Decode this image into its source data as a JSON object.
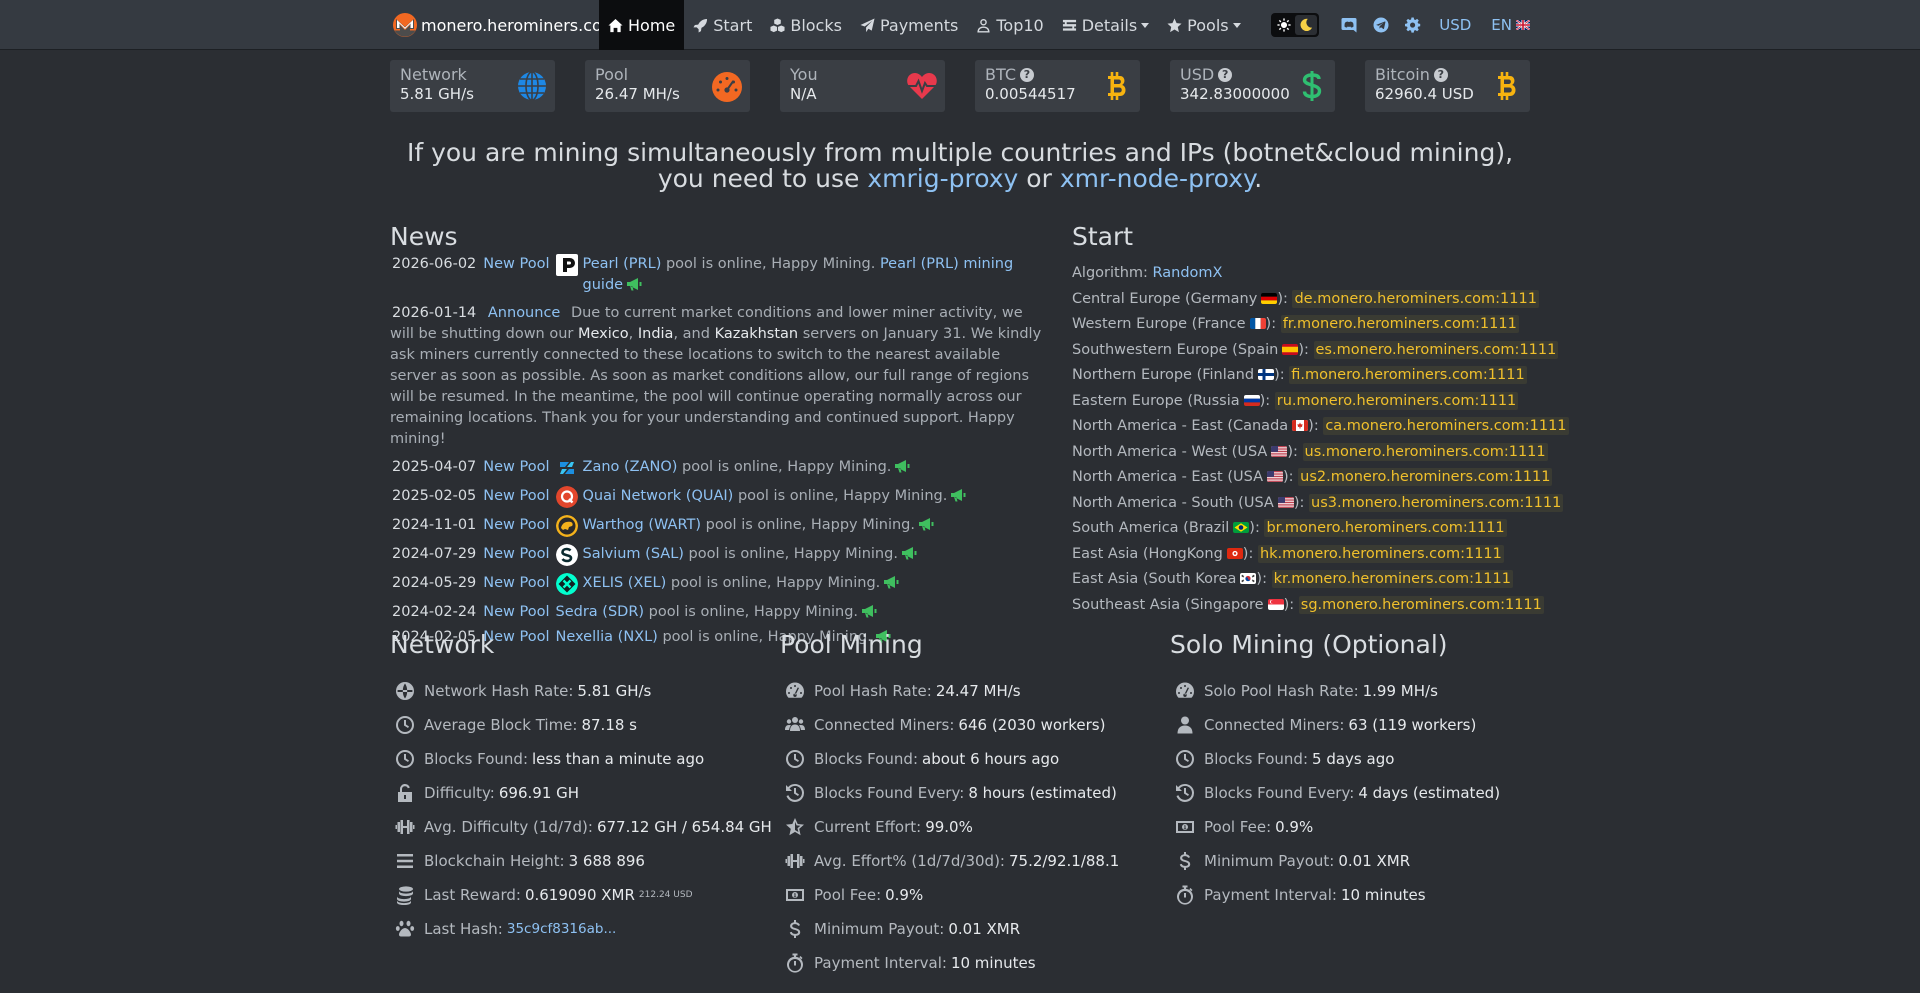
{
  "nav": {
    "brand": "monero.herominers.com",
    "items": [
      {
        "label": "Home",
        "icon": "home-icon",
        "active": true
      },
      {
        "label": "Start",
        "icon": "rocket-icon"
      },
      {
        "label": "Blocks",
        "icon": "cubes-icon"
      },
      {
        "label": "Payments",
        "icon": "paper-plane-icon"
      },
      {
        "label": "Top10",
        "icon": "user-icon"
      },
      {
        "label": "Details",
        "icon": "list-icon",
        "dropdown": true
      },
      {
        "label": "Pools",
        "icon": "star-icon",
        "dropdown": true
      }
    ],
    "currency": "USD",
    "language": "EN"
  },
  "stats": {
    "network": {
      "label": "Network",
      "value": "5.81 GH/s"
    },
    "pool": {
      "label": "Pool",
      "value": "26.47 MH/s"
    },
    "you": {
      "label": "You",
      "value": "N/A"
    },
    "btc": {
      "label": "BTC",
      "value": "0.00544517"
    },
    "usd": {
      "label": "USD",
      "value": "342.83000000"
    },
    "bitcoin": {
      "label": "Bitcoin",
      "value": "62960.4 USD"
    }
  },
  "banner": {
    "text_1": "If you are mining simultaneously from multiple countries and IPs (botnet&cloud mining), you need to use ",
    "link_1": "xmrig-proxy",
    "text_2": " or ",
    "link_2": "xmr-node-proxy",
    "text_3": "."
  },
  "news": {
    "title": "News",
    "items": [
      {
        "date": "2026-06-02",
        "tag": "New Pool",
        "coin": "Pearl (PRL)",
        "msg": " pool is online, Happy Mining. ",
        "guide": "Pearl (PRL) mining guide",
        "icon": "pearl-icon"
      },
      {
        "date": "2025-04-07",
        "tag": "New Pool",
        "coin": "Zano (ZANO)",
        "msg": " pool is online, Happy Mining.",
        "icon": "zano-icon"
      },
      {
        "date": "2025-02-05",
        "tag": "New Pool",
        "coin": "Quai Network (QUAI)",
        "msg": " pool is online, Happy Mining.",
        "icon": "quai-icon"
      },
      {
        "date": "2024-11-01",
        "tag": "New Pool",
        "coin": "Warthog (WART)",
        "msg": " pool is online, Happy Mining.",
        "icon": "warthog-icon"
      },
      {
        "date": "2024-07-29",
        "tag": "New Pool",
        "coin": "Salvium (SAL)",
        "msg": " pool is online, Happy Mining.",
        "icon": "salvium-icon"
      },
      {
        "date": "2024-05-29",
        "tag": "New Pool",
        "coin": "XELIS (XEL)",
        "msg": " pool is online, Happy Mining.",
        "icon": "xelis-icon"
      },
      {
        "date": "2024-02-24",
        "tag": "New Pool",
        "coin": "Sedra (SDR)",
        "msg": " pool is online, Happy Mining."
      },
      {
        "date": "2024-02-05",
        "tag": "New Pool",
        "coin": "Nexellia (NXL)",
        "msg": " pool is online, Happy Mining."
      }
    ],
    "announce": {
      "date": "2026-01-14",
      "tag": "Announce",
      "p1": " Due to current market conditions and lower miner activity, we will be shutting down our ",
      "c1": "Mexico",
      "p2": ", ",
      "c2": "India",
      "p3": ", and ",
      "c3": "Kazakhstan",
      "p4": " servers on January 31. We kindly ask miners currently connected to these locations to switch to the nearest available server as soon as possible. As soon as market conditions allow, our full range of regions will be resumed. In the meantime, the pool will continue operating normally across our remaining locations. Thank you for your understanding and continued support. Happy mining!"
    }
  },
  "start": {
    "title": "Start",
    "algorithm_label": "Algorithm: ",
    "algorithm": "RandomX",
    "servers": [
      {
        "region": "Central Europe (Germany",
        "flag": "de",
        "host": "de.monero.herominers.com:1111"
      },
      {
        "region": "Western Europe (France",
        "flag": "fr",
        "host": "fr.monero.herominers.com:1111"
      },
      {
        "region": "Southwestern Europe (Spain",
        "flag": "es",
        "host": "es.monero.herominers.com:1111"
      },
      {
        "region": "Northern Europe (Finland",
        "flag": "fi",
        "host": "fi.monero.herominers.com:1111"
      },
      {
        "region": "Eastern Europe (Russia",
        "flag": "ru",
        "host": "ru.monero.herominers.com:1111"
      },
      {
        "region": "North America - East (Canada",
        "flag": "ca",
        "host": "ca.monero.herominers.com:1111"
      },
      {
        "region": "North America - West (USA",
        "flag": "us",
        "host": "us.monero.herominers.com:1111"
      },
      {
        "region": "North America - East (USA",
        "flag": "us",
        "host": "us2.monero.herominers.com:1111"
      },
      {
        "region": "North America - South (USA",
        "flag": "us",
        "host": "us3.monero.herominers.com:1111"
      },
      {
        "region": "South America (Brazil",
        "flag": "br",
        "host": "br.monero.herominers.com:1111"
      },
      {
        "region": "East Asia (HongKong",
        "flag": "hk",
        "host": "hk.monero.herominers.com:1111"
      },
      {
        "region": "East Asia (South Korea",
        "flag": "kr",
        "host": "kr.monero.herominers.com:1111"
      },
      {
        "region": "Southeast Asia (Singapore",
        "flag": "sg",
        "host": "sg.monero.herominers.com:1111"
      }
    ]
  },
  "network": {
    "title": "Network",
    "rows": [
      {
        "icon": "globe-icon",
        "k": "Network Hash Rate:",
        "v": "5.81 GH/s"
      },
      {
        "icon": "clock-icon",
        "k": "Average Block Time:",
        "v": "87.18 s"
      },
      {
        "icon": "clock-icon",
        "k": "Blocks Found:",
        "v": "less than a minute ago"
      },
      {
        "icon": "unlock-icon",
        "k": "Difficulty:",
        "v": "696.91 GH"
      },
      {
        "icon": "dumbbell-icon",
        "k": "Avg. Difficulty (1d/7d):",
        "v": "677.12 GH / 654.84 GH"
      },
      {
        "icon": "bars-icon",
        "k": "Blockchain Height:",
        "v": "3 688 896"
      },
      {
        "icon": "coins-icon",
        "k": "Last Reward:",
        "v": "0.619090 XMR",
        "sup": "212.24 USD"
      },
      {
        "icon": "paw-icon",
        "k": "Last Hash:",
        "v": "35c9cf8316ab...",
        "link": true
      }
    ]
  },
  "pool_mining": {
    "title": "Pool Mining",
    "rows": [
      {
        "icon": "gauge-icon",
        "k": "Pool Hash Rate:",
        "v": "24.47 MH/s"
      },
      {
        "icon": "users-icon",
        "k": "Connected Miners:",
        "v": "646 (2030 workers)"
      },
      {
        "icon": "clock-icon",
        "k": "Blocks Found:",
        "v": "about 6 hours ago"
      },
      {
        "icon": "history-icon",
        "k": "Blocks Found Every:",
        "v": "8 hours (estimated)"
      },
      {
        "icon": "star-half-icon",
        "k": "Current Effort:",
        "v": "99.0%"
      },
      {
        "icon": "dumbbell-icon",
        "k": "Avg. Effort% (1d/7d/30d):",
        "v": "75.2/92.1/88.1"
      },
      {
        "icon": "money-icon",
        "k": "Pool Fee:",
        "v": "0.9%"
      },
      {
        "icon": "dollar-icon",
        "k": "Minimum Payout:",
        "v": "0.01 XMR"
      },
      {
        "icon": "stopwatch-icon",
        "k": "Payment Interval:",
        "v": "10 minutes"
      }
    ]
  },
  "solo_mining": {
    "title": "Solo Mining (Optional)",
    "rows": [
      {
        "icon": "gauge-icon",
        "k": "Solo Pool Hash Rate:",
        "v": "1.99 MH/s"
      },
      {
        "icon": "user-icon",
        "k": "Connected Miners:",
        "v": "63 (119 workers)"
      },
      {
        "icon": "clock-icon",
        "k": "Blocks Found:",
        "v": "5 days ago"
      },
      {
        "icon": "history-icon",
        "k": "Blocks Found Every:",
        "v": "4 days (estimated)"
      },
      {
        "icon": "money-icon",
        "k": "Pool Fee:",
        "v": "0.9%"
      },
      {
        "icon": "dollar-icon",
        "k": "Minimum Payout:",
        "v": "0.01 XMR"
      },
      {
        "icon": "stopwatch-icon",
        "k": "Payment Interval:",
        "v": "10 minutes"
      }
    ]
  },
  "colors": {
    "background": "#2b2e33",
    "navbar": "#353a41",
    "link": "#8ec1f2",
    "server": "#f0c02c",
    "monero": "#f26822",
    "bitcoin": "#f7b30f",
    "dollar": "#2fbf71",
    "heart": "#e8394c",
    "globe": "#1e88e5",
    "megaphone": "#3fbf5f"
  }
}
